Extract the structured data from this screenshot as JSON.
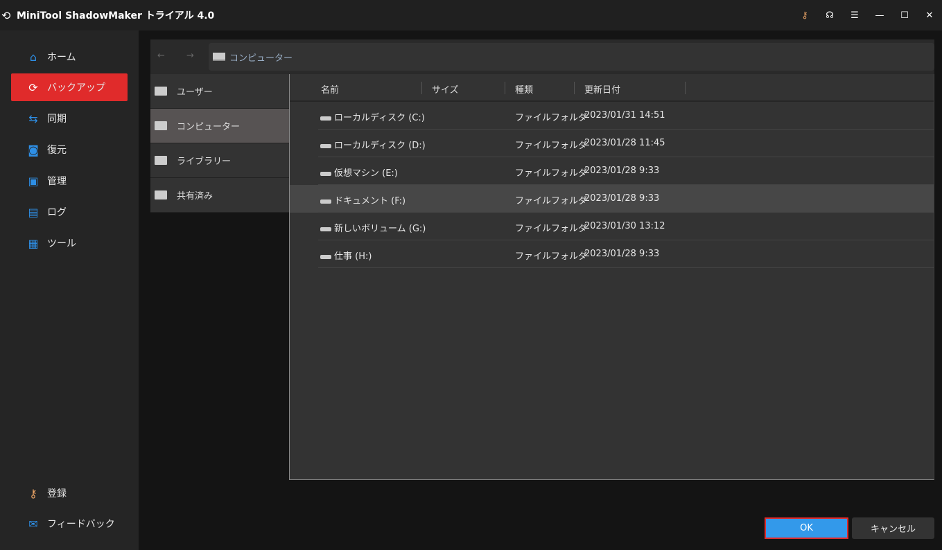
{
  "app": {
    "title": "MiniTool ShadowMaker トライアル 4.0"
  },
  "titlebar": {
    "icons": [
      "key-icon",
      "headset-icon",
      "menu-icon",
      "minimize-icon",
      "maximize-icon",
      "close-icon"
    ],
    "key_color": "#e8a265"
  },
  "sidebar": {
    "items": [
      {
        "label": "ホーム",
        "icon": "home-icon"
      },
      {
        "label": "バックアップ",
        "icon": "backup-icon",
        "active": true
      },
      {
        "label": "同期",
        "icon": "sync-icon"
      },
      {
        "label": "復元",
        "icon": "restore-icon"
      },
      {
        "label": "管理",
        "icon": "manage-icon"
      },
      {
        "label": "ログ",
        "icon": "log-icon"
      },
      {
        "label": "ツール",
        "icon": "tools-icon"
      }
    ],
    "bottom": [
      {
        "label": "登録",
        "icon": "key-icon"
      },
      {
        "label": "フィードバック",
        "icon": "mail-icon"
      }
    ],
    "active_color": "#e02b2b",
    "icon_color": "#2e8fe6"
  },
  "breadcrumb": {
    "path": "コンピューター"
  },
  "tree": [
    {
      "label": "ユーザー"
    },
    {
      "label": "コンピューター",
      "selected": true
    },
    {
      "label": "ライブラリー"
    },
    {
      "label": "共有済み"
    }
  ],
  "list": {
    "columns": [
      "名前",
      "サイズ",
      "種類",
      "更新日付"
    ],
    "rows": [
      {
        "name": "ローカルディスク (C:)",
        "size": "",
        "type": "ファイルフォルダ",
        "date": "2023/01/31 14:51"
      },
      {
        "name": "ローカルディスク (D:)",
        "size": "",
        "type": "ファイルフォルダ",
        "date": "2023/01/28 11:45"
      },
      {
        "name": "仮想マシン (E:)",
        "size": "",
        "type": "ファイルフォルダ",
        "date": "2023/01/28 9:33"
      },
      {
        "name": "ドキュメント (F:)",
        "size": "",
        "type": "ファイルフォルダ",
        "date": "2023/01/28 9:33",
        "selected": true
      },
      {
        "name": "新しいボリューム (G:)",
        "size": "",
        "type": "ファイルフォルダ",
        "date": "2023/01/30 13:12"
      },
      {
        "name": "仕事 (H:)",
        "size": "",
        "type": "ファイルフォルダ",
        "date": "2023/01/28 9:33"
      }
    ]
  },
  "buttons": {
    "ok": "OK",
    "cancel": "キャンセル",
    "ok_color": "#3399ea"
  }
}
